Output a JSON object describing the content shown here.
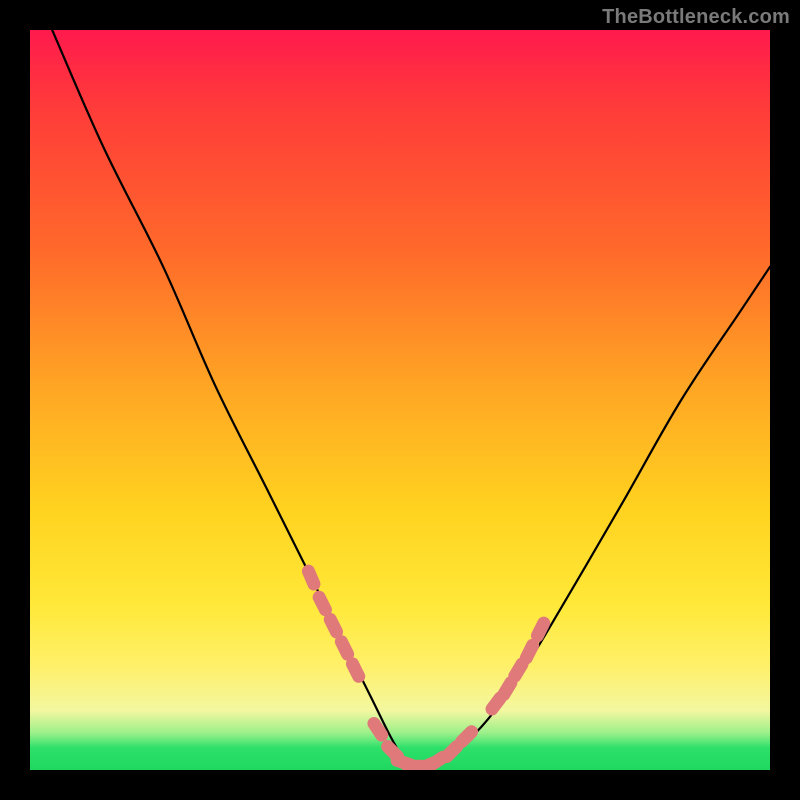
{
  "watermark": "TheBottleneck.com",
  "chart_data": {
    "type": "line",
    "title": "",
    "xlabel": "",
    "ylabel": "",
    "xlim": [
      0,
      100
    ],
    "ylim": [
      0,
      100
    ],
    "grid": false,
    "legend": false,
    "series": [
      {
        "name": "bottleneck-curve",
        "x": [
          3,
          10,
          18,
          25,
          32,
          38,
          42,
          46,
          49,
          51,
          53,
          55,
          58,
          62,
          67,
          73,
          80,
          88,
          96,
          100
        ],
        "values": [
          100,
          84,
          68,
          52,
          38,
          26,
          18,
          10,
          4,
          1,
          0,
          1,
          3,
          7,
          14,
          24,
          36,
          50,
          62,
          68
        ]
      }
    ],
    "marker_clusters": [
      {
        "name": "left-cluster",
        "x": [
          38,
          39.5,
          41,
          42.5,
          44
        ],
        "values": [
          26,
          22.5,
          19.5,
          16.5,
          13.5
        ]
      },
      {
        "name": "bottom-cluster",
        "x": [
          47,
          49,
          50.5,
          52,
          53.5,
          55,
          57,
          59
        ],
        "values": [
          5.5,
          2.5,
          1,
          0.5,
          0.5,
          1.2,
          2.5,
          4.5
        ]
      },
      {
        "name": "right-cluster",
        "x": [
          63,
          64.5,
          66,
          67.5,
          69
        ],
        "values": [
          9,
          11,
          13.5,
          16,
          19
        ]
      }
    ],
    "colors": {
      "curve": "#000000",
      "marker_fill": "#e07a7a",
      "marker_stroke": "#d46a6a"
    }
  }
}
